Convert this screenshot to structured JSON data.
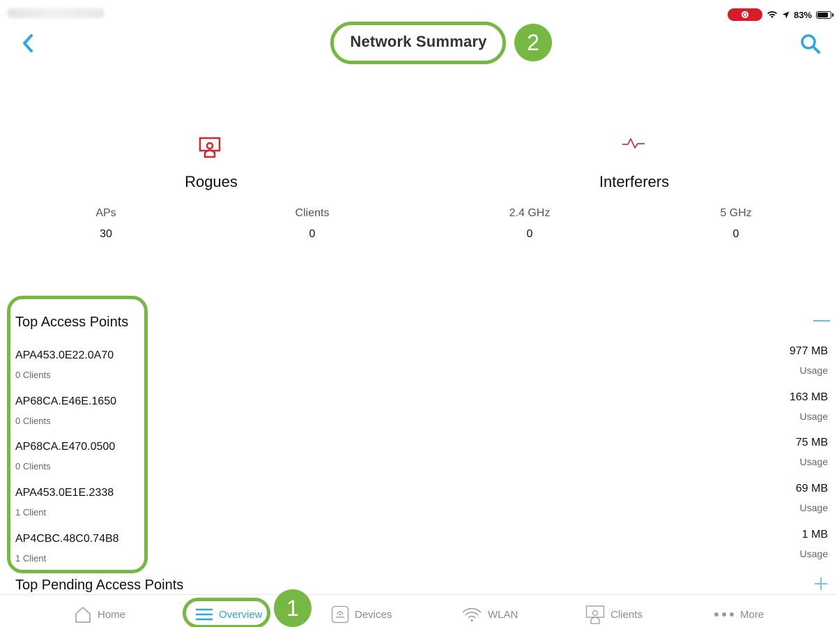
{
  "status_bar": {
    "battery": "83%",
    "battery_level": 0.83
  },
  "header": {
    "title": "Network Summary"
  },
  "annotations": {
    "step_1": "1",
    "step_2": "2"
  },
  "summary": {
    "rogues": {
      "heading": "Rogues",
      "icon": "rogue-ap-icon",
      "metrics": [
        {
          "label": "APs",
          "value": "30"
        },
        {
          "label": "Clients",
          "value": "0"
        }
      ]
    },
    "interferers": {
      "heading": "Interferers",
      "icon": "interference-wave-icon",
      "metrics": [
        {
          "label": "2.4 GHz",
          "value": "0"
        },
        {
          "label": "5 GHz",
          "value": "0"
        }
      ]
    }
  },
  "top_access_points": {
    "title": "Top Access Points",
    "items": [
      {
        "name": "APA453.0E22.0A70",
        "clients": "0 Clients",
        "usage": "977 MB",
        "usage_label": "Usage"
      },
      {
        "name": "AP68CA.E46E.1650",
        "clients": "0 Clients",
        "usage": "163 MB",
        "usage_label": "Usage"
      },
      {
        "name": "AP68CA.E470.0500",
        "clients": "0 Clients",
        "usage": "75 MB",
        "usage_label": "Usage"
      },
      {
        "name": "APA453.0E1E.2338",
        "clients": "1 Client",
        "usage": "69 MB",
        "usage_label": "Usage"
      },
      {
        "name": "AP4CBC.48C0.74B8",
        "clients": "1 Client",
        "usage": "1 MB",
        "usage_label": "Usage"
      }
    ]
  },
  "top_pending_access_points": {
    "title": "Top Pending Access Points"
  },
  "tabs": [
    {
      "label": "Home",
      "icon": "home-icon",
      "active": false
    },
    {
      "label": "Overview",
      "icon": "menu-lines-icon",
      "active": true
    },
    {
      "label": "Devices",
      "icon": "device-icon",
      "active": false
    },
    {
      "label": "WLAN",
      "icon": "wifi-icon",
      "active": false
    },
    {
      "label": "Clients",
      "icon": "clients-icon",
      "active": false
    },
    {
      "label": "More",
      "icon": "more-dots-icon",
      "active": false
    }
  ],
  "colors": {
    "accent": "#2fa8d8",
    "highlight": "#76b843",
    "rogue": "#d0282f",
    "record": "#d61e2a"
  }
}
